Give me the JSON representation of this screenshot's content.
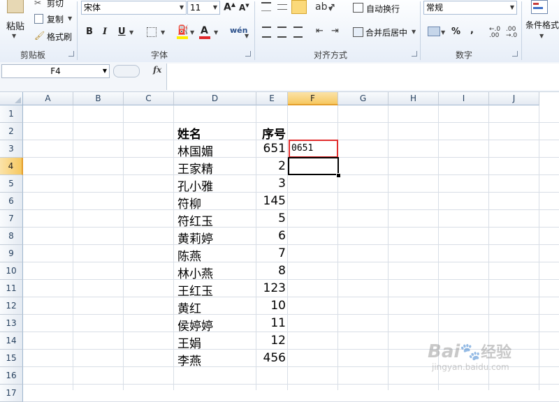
{
  "ribbon": {
    "clipboard": {
      "cut": "剪切",
      "copy": "复制",
      "format_painter": "格式刷",
      "paste": "粘贴",
      "group": "剪贴板"
    },
    "font": {
      "name": "宋体",
      "size": "11",
      "bold": "B",
      "italic": "I",
      "underline": "U",
      "group": "字体"
    },
    "alignment": {
      "wrap_text": "自动换行",
      "merge_center": "合并后居中",
      "group": "对齐方式"
    },
    "number": {
      "format": "常规",
      "percent": "%",
      "comma": ",",
      "inc_decimal": "+.0\n.00",
      "dec_decimal": ".00\n→.0",
      "group": "数字"
    },
    "styles": {
      "conditional": "条件格式"
    }
  },
  "formula_bar": {
    "name_box": "F4",
    "fx": "fx",
    "formula": ""
  },
  "sheet": {
    "columns": [
      "A",
      "B",
      "C",
      "D",
      "E",
      "F",
      "G",
      "H",
      "I",
      "J"
    ],
    "selected_column": "F",
    "rows": [
      "1",
      "2",
      "3",
      "4",
      "5",
      "6",
      "7",
      "8",
      "9",
      "10",
      "11",
      "12",
      "13",
      "14",
      "15",
      "16",
      "17"
    ],
    "selected_row": "4",
    "header_name": "姓名",
    "header_num": "序号",
    "f3_value": "0651",
    "data": [
      {
        "name": "林国媚",
        "num": "651"
      },
      {
        "name": "王家精",
        "num": "2"
      },
      {
        "name": "孔小雅",
        "num": "3"
      },
      {
        "name": "符柳",
        "num": "145"
      },
      {
        "name": "符红玉",
        "num": "5"
      },
      {
        "name": "黄莉婷",
        "num": "6"
      },
      {
        "name": "陈燕",
        "num": "7"
      },
      {
        "name": "林小燕",
        "num": "8"
      },
      {
        "name": "王红玉",
        "num": "123"
      },
      {
        "name": "黄红",
        "num": "10"
      },
      {
        "name": "侯婷婷",
        "num": "11"
      },
      {
        "name": "王娟",
        "num": "12"
      },
      {
        "name": "李燕",
        "num": "456"
      }
    ]
  },
  "watermark": {
    "brand": "Bai",
    "brand2": "经验",
    "url": "jingyan.baidu.com"
  },
  "colors": {
    "highlight": "#e02d2d",
    "selected_header": "#f6c860",
    "accent_font": "#e0262a",
    "fill_yellow": "#ffee00"
  }
}
